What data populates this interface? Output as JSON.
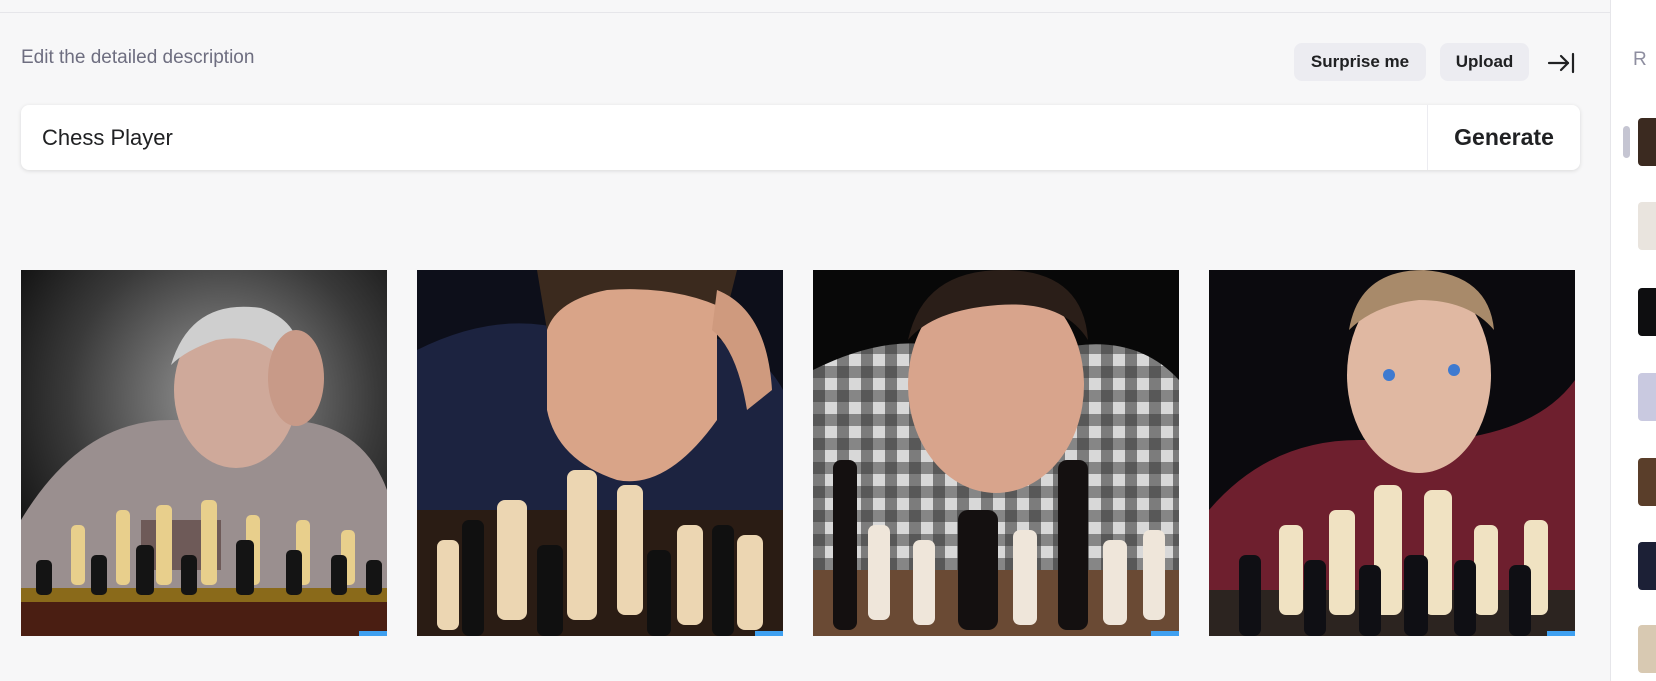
{
  "header": {
    "label": "Edit the detailed description",
    "surprise_label": "Surprise me",
    "upload_label": "Upload",
    "collapse_icon": "arrow-right-to-bar-icon"
  },
  "prompt": {
    "value": "Chess Player",
    "generate_label": "Generate"
  },
  "results": [
    {
      "name": "chess-player-image-1",
      "description": "grey-haired man thinking over chessboard"
    },
    {
      "name": "chess-player-image-2",
      "description": "young man in navy shirt looking down at chess pieces"
    },
    {
      "name": "chess-player-image-3",
      "description": "man in plaid shirt staring over chess pieces"
    },
    {
      "name": "chess-player-image-4",
      "description": "man in maroon shirt with chess pieces"
    }
  ],
  "sidebar": {
    "header_letter": "R",
    "thumbnail_count": 7
  },
  "colors": {
    "background": "#f7f7f8",
    "button_bg": "#ececf1",
    "text": "#202123",
    "muted_text": "#6e6e80"
  }
}
